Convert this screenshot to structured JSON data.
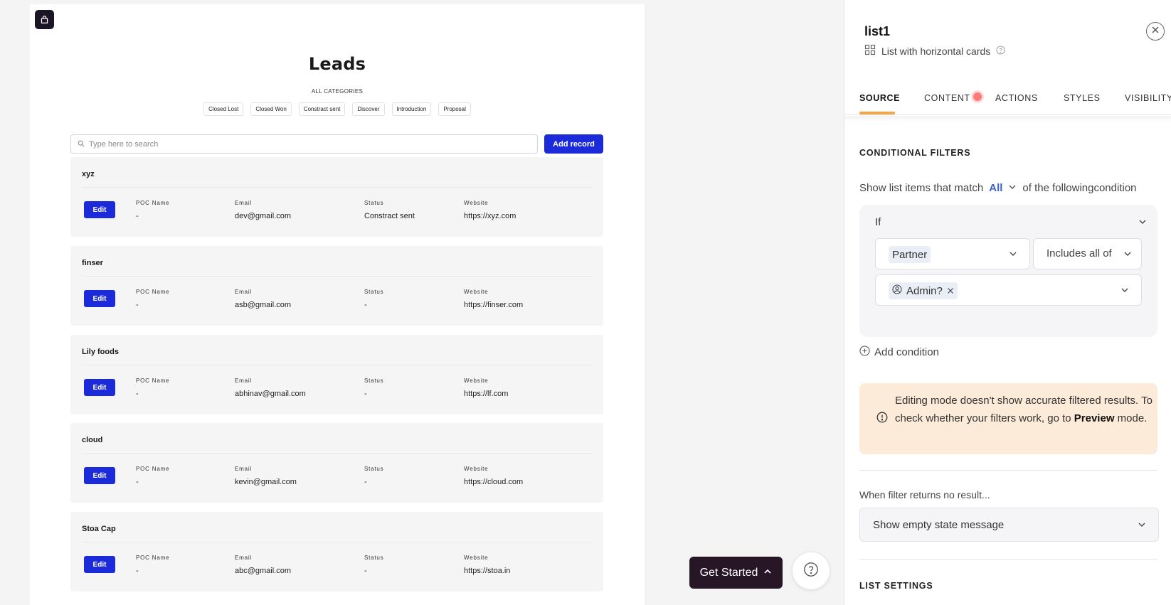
{
  "canvas": {
    "page_title": "Leads",
    "categories_label": "ALL CATEGORIES",
    "categories": [
      "Closed Lost",
      "Closed Won",
      "Constract sent",
      "Discover",
      "Introduction",
      "Proposal"
    ],
    "search_placeholder": "Type here to search",
    "add_record_label": "Add record",
    "edit_label": "Edit",
    "field_labels": {
      "poc": "POC Name",
      "email": "Email",
      "status": "Status",
      "website": "Website"
    },
    "records": [
      {
        "name": "xyz",
        "poc": "-",
        "email": "dev@gmail.com",
        "status": "Constract sent",
        "website": "https://xyz.com"
      },
      {
        "name": "finser",
        "poc": "-",
        "email": "asb@gmail.com",
        "status": "-",
        "website": "https://finser.com"
      },
      {
        "name": "Lily foods",
        "poc": "-",
        "email": "abhinav@gmail.com",
        "status": "-",
        "website": "https://lf.com"
      },
      {
        "name": "cloud",
        "poc": "-",
        "email": "kevin@gmail.com",
        "status": "-",
        "website": "https://cloud.com"
      },
      {
        "name": "Stoa Cap",
        "poc": "-",
        "email": "abc@gmail.com",
        "status": "-",
        "website": "https://stoa.in"
      }
    ]
  },
  "panel": {
    "title": "list1",
    "subtitle": "List with horizontal cards",
    "tabs": [
      "SOURCE",
      "CONTENT",
      "ACTIONS",
      "STYLES",
      "VISIBILITY"
    ],
    "active_tab": "SOURCE",
    "conditional_filters": {
      "heading": "CONDITIONAL FILTERS",
      "match_prefix": "Show list items that match",
      "match_value": "All",
      "match_suffix": "of the followingcondition",
      "if_label": "If",
      "field": "Partner",
      "operator": "Includes all of",
      "value_tag": "Admin?",
      "add_condition": "Add condition"
    },
    "warning": {
      "line1": "Editing mode doesn't show accurate filtered results. To check whether your filters work, go to",
      "emphasis": "Preview",
      "line2": "mode."
    },
    "no_result": {
      "label": "When filter returns no result...",
      "value": "Show empty state message"
    },
    "list_settings_heading": "LIST SETTINGS"
  },
  "floating": {
    "get_started": "Get Started"
  },
  "colors": {
    "primary_button": "#1c2bd9",
    "tab_accent": "#f5a446",
    "link_accent": "#3a63c6",
    "warning_bg": "#fdebd9",
    "dark_button": "#271726"
  }
}
